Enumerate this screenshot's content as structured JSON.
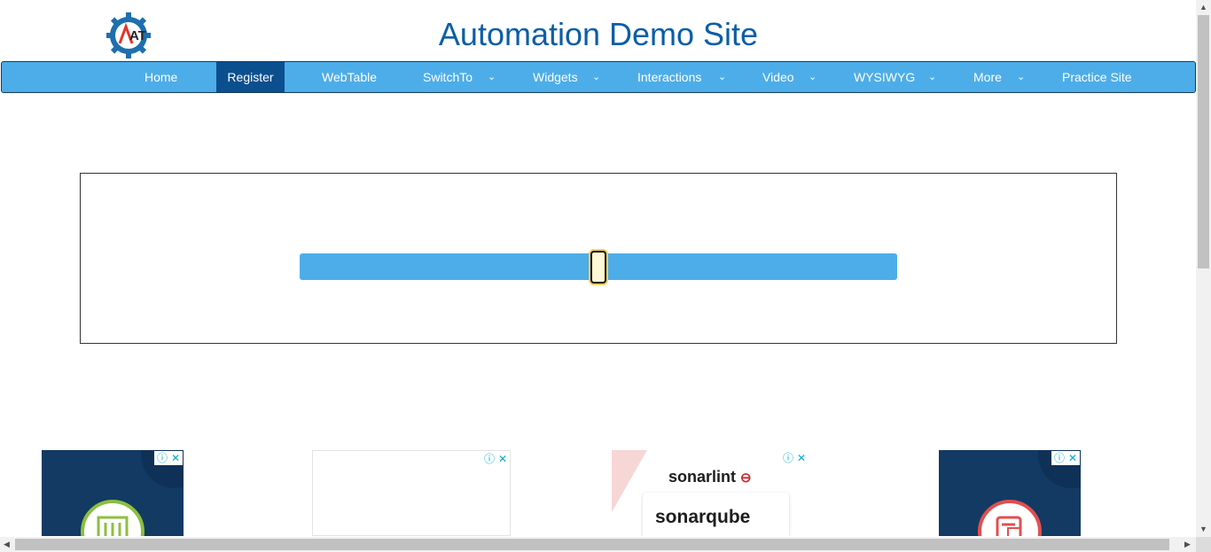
{
  "header": {
    "title": "Automation Demo Site",
    "logo_icon": "gear-logo-icon",
    "logo_text": "AT"
  },
  "nav": {
    "items": [
      {
        "label": "Home",
        "dropdown": false
      },
      {
        "label": "Register",
        "dropdown": false,
        "active": true
      },
      {
        "label": "WebTable",
        "dropdown": false
      },
      {
        "label": "SwitchTo",
        "dropdown": true
      },
      {
        "label": "Widgets",
        "dropdown": true
      },
      {
        "label": "Interactions",
        "dropdown": true
      },
      {
        "label": "Video",
        "dropdown": true
      },
      {
        "label": "WYSIWYG",
        "dropdown": true
      },
      {
        "label": "More",
        "dropdown": true
      },
      {
        "label": "Practice Site",
        "dropdown": false
      }
    ],
    "chevron": "⌄"
  },
  "slider": {
    "value_fraction": 0.5
  },
  "ads": {
    "info_glyph": "ⓘ",
    "close_glyph": "✕",
    "items": [
      {
        "kind": "dark",
        "icon": "server-icon"
      },
      {
        "kind": "blank"
      },
      {
        "kind": "sonar",
        "brand_1": "sonarlint",
        "brand_2": "sonarqube"
      },
      {
        "kind": "dark",
        "icon": "report-icon"
      }
    ]
  },
  "colors": {
    "nav_bg": "#4dade8",
    "nav_active": "#0b4f8f",
    "title": "#0b5ea8",
    "slider_track": "#4dade8"
  }
}
